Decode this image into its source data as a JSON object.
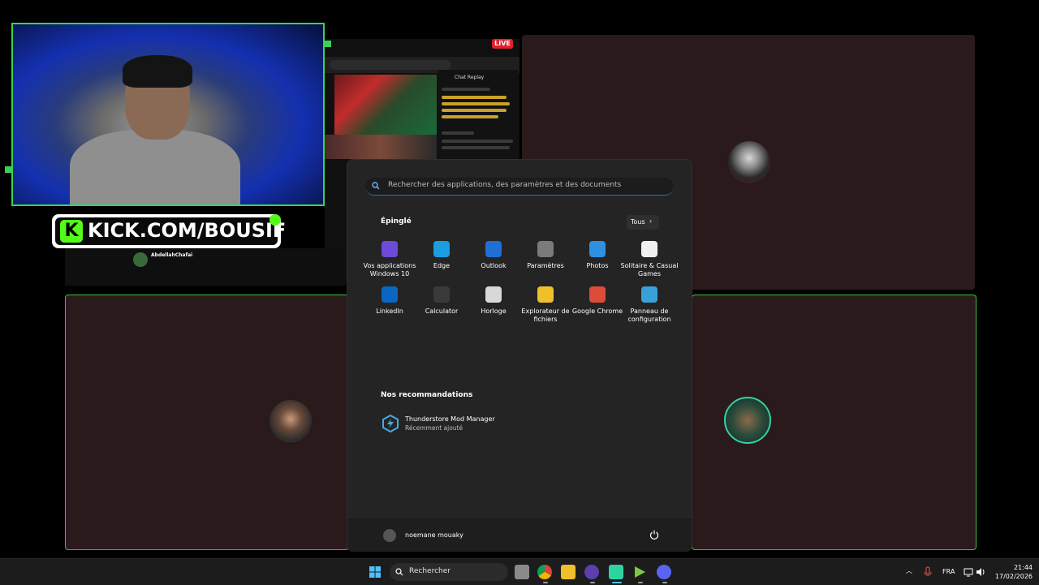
{
  "overlay": {
    "live_badge": "LIVE",
    "kick_logo": "K",
    "kick_text": "KICK.COM/BOUSIF",
    "chat_title": "Chat Replay",
    "channel_name": "AbdellahChafai"
  },
  "start_menu": {
    "search_placeholder": "Rechercher des applications, des paramètres et des documents",
    "pinned_title": "Épinglé",
    "all_button": "Tous",
    "pinned_apps": [
      {
        "label": "Vos applications Windows 10",
        "icon": "windows-apps-icon",
        "color": "#6d4bd8"
      },
      {
        "label": "Edge",
        "icon": "edge-icon",
        "color": "#1b9de2"
      },
      {
        "label": "Outlook",
        "icon": "outlook-icon",
        "color": "#1f6fd6"
      },
      {
        "label": "Paramètres",
        "icon": "settings-icon",
        "color": "#7a7a7a"
      },
      {
        "label": "Photos",
        "icon": "photos-icon",
        "color": "#2f8fe0"
      },
      {
        "label": "Solitaire & Casual Games",
        "icon": "solitaire-icon",
        "color": "#f0f0f0"
      },
      {
        "label": "LinkedIn",
        "icon": "linkedin-icon",
        "color": "#0a66c2"
      },
      {
        "label": "Calculator",
        "icon": "calculator-icon",
        "color": "#3a3a3a"
      },
      {
        "label": "Horloge",
        "icon": "clock-icon",
        "color": "#d8d8d8"
      },
      {
        "label": "Explorateur de fichiers",
        "icon": "folder-icon",
        "color": "#f0c02a"
      },
      {
        "label": "Google Chrome",
        "icon": "chrome-icon",
        "color": "#dd4b39"
      },
      {
        "label": "Panneau de configuration",
        "icon": "control-panel-icon",
        "color": "#3aa0d8"
      }
    ],
    "recommendations_title": "Nos recommandations",
    "recommendations": [
      {
        "name": "Thunderstore Mod Manager",
        "subtitle": "Récemment ajouté",
        "icon": "thunderstore-icon"
      }
    ],
    "user_name": "noemane mouaky"
  },
  "taskbar": {
    "search_label": "Rechercher",
    "language": "FRA",
    "time": "21:44",
    "date": "17/02/2026"
  },
  "colors": {
    "accent": "#39d353",
    "kick_green": "#53fc18",
    "tile_bg": "#2a1a1c"
  }
}
